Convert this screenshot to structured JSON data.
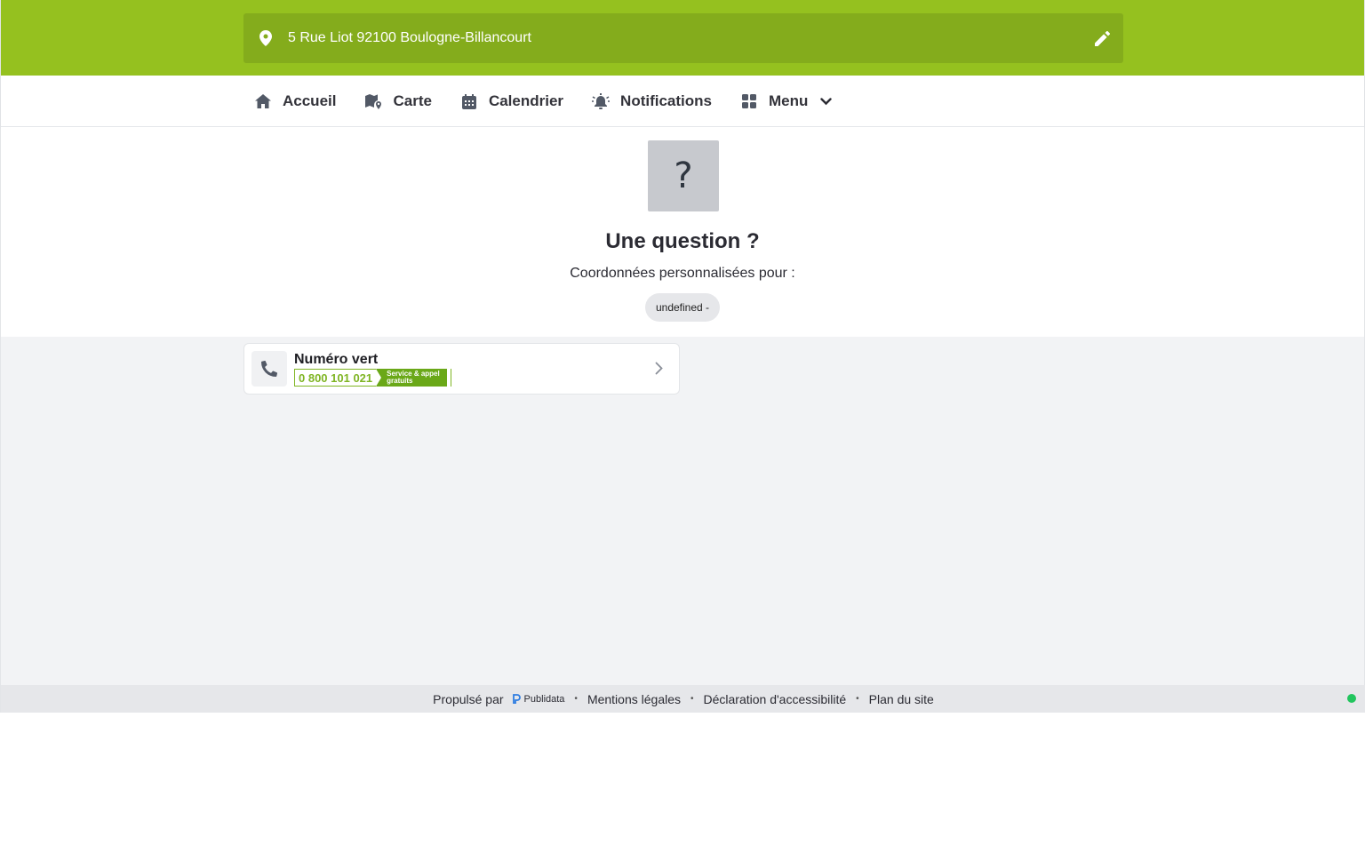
{
  "header": {
    "address": "5 Rue Liot 92100 Boulogne-Billancourt",
    "edit_icon": "pencil-icon",
    "location_icon": "map-pin-icon"
  },
  "nav": {
    "items": [
      {
        "label": "Accueil",
        "icon": "home-icon"
      },
      {
        "label": "Carte",
        "icon": "map-icon"
      },
      {
        "label": "Calendrier",
        "icon": "calendar-icon"
      },
      {
        "label": "Notifications",
        "icon": "alarm-bell-icon"
      },
      {
        "label": "Menu",
        "icon": "grid-icon"
      }
    ]
  },
  "hero": {
    "icon_glyph": "?",
    "title": "Une question ?",
    "subtitle": "Coordonnées personnalisées pour :",
    "pill": "undefined -"
  },
  "contact_card": {
    "title": "Numéro vert",
    "number": "0 800 101 021",
    "tag_line1": "Service & appel",
    "tag_line2": "gratuits"
  },
  "footer": {
    "powered_by": "Propulsé par",
    "brand": "Publidata",
    "links": [
      "Mentions légales",
      "Déclaration d'accessibilité",
      "Plan du site"
    ]
  },
  "colors": {
    "brand_green": "#95c11f",
    "address_bar": "#84ac1c",
    "status_green": "#22c55e"
  }
}
